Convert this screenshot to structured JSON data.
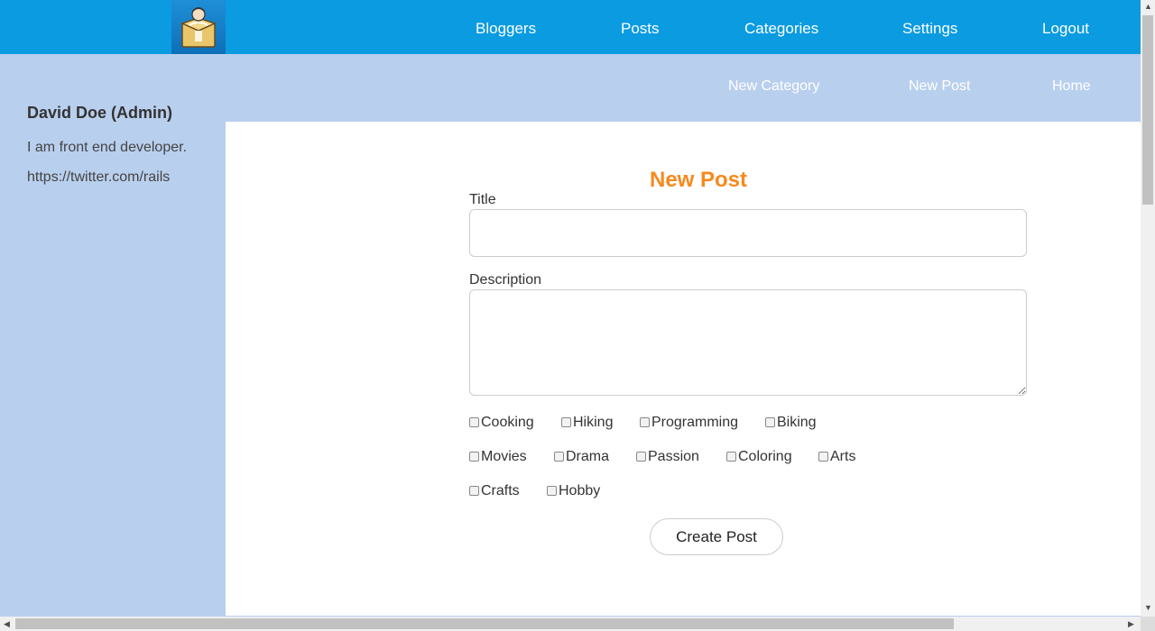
{
  "topnav": {
    "items": [
      {
        "label": "Bloggers"
      },
      {
        "label": "Posts"
      },
      {
        "label": "Categories"
      },
      {
        "label": "Settings"
      },
      {
        "label": "Logout"
      }
    ]
  },
  "subnav": {
    "items": [
      {
        "label": "New Category"
      },
      {
        "label": "New Post"
      },
      {
        "label": "Home"
      }
    ]
  },
  "profile": {
    "name": "David Doe (Admin)",
    "bio": "I am front end developer.",
    "link": "https://twitter.com/rails"
  },
  "form": {
    "heading": "New Post",
    "title_label": "Title",
    "title_value": "",
    "description_label": "Description",
    "description_value": "",
    "categories": [
      {
        "label": "Cooking"
      },
      {
        "label": "Hiking"
      },
      {
        "label": "Programming"
      },
      {
        "label": "Biking"
      },
      {
        "label": "Movies"
      },
      {
        "label": "Drama"
      },
      {
        "label": "Passion"
      },
      {
        "label": "Coloring"
      },
      {
        "label": "Arts"
      },
      {
        "label": "Crafts"
      },
      {
        "label": "Hobby"
      }
    ],
    "submit_label": "Create Post"
  },
  "colors": {
    "topbar": "#0a9be1",
    "sidebar": "#b9cfee",
    "heading": "#f7891d"
  }
}
